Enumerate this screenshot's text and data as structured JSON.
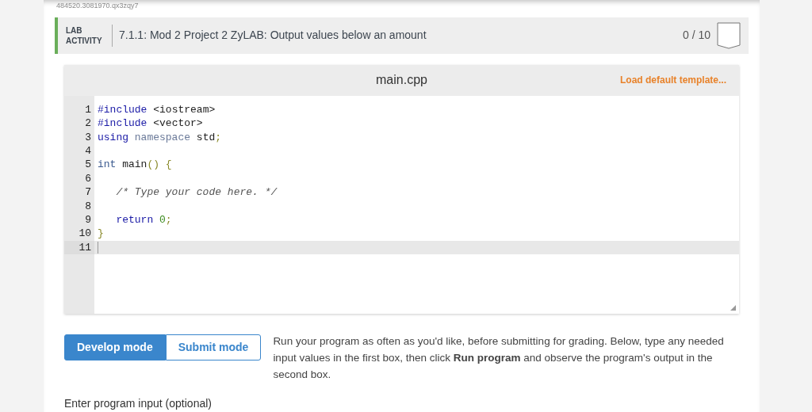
{
  "top_id": "484520.3081970.qx3zqy7",
  "activity": {
    "label": "LAB ACTIVITY",
    "title": "7.1.1: Mod 2 Project 2 ZyLAB: Output values below an amount",
    "score": "0 / 10",
    "completed": false
  },
  "editor": {
    "filename": "main.cpp",
    "load_template": "Load default template...",
    "lines": [
      {
        "number": "1",
        "current": false,
        "tokens": [
          {
            "kind": "keyword",
            "text": "#include"
          },
          {
            "kind": "plain",
            "text": " <iostream>"
          }
        ]
      },
      {
        "number": "2",
        "current": false,
        "tokens": [
          {
            "kind": "keyword",
            "text": "#include"
          },
          {
            "kind": "plain",
            "text": " <vector>"
          }
        ]
      },
      {
        "number": "3",
        "current": false,
        "tokens": [
          {
            "kind": "keyword",
            "text": "using"
          },
          {
            "kind": "muted",
            "text": " namespace"
          },
          {
            "kind": "plain",
            "text": " std"
          },
          {
            "kind": "punct",
            "text": ";"
          }
        ]
      },
      {
        "number": "4",
        "current": false
      },
      {
        "number": "5",
        "current": false,
        "tokens": [
          {
            "kind": "type",
            "text": "int"
          },
          {
            "kind": "plain",
            "text": " main"
          },
          {
            "kind": "punct",
            "text": "() {"
          }
        ]
      },
      {
        "number": "6",
        "current": false
      },
      {
        "number": "7",
        "current": false,
        "tokens": [
          {
            "kind": "comment",
            "text": "   /* Type your code here. */"
          }
        ]
      },
      {
        "number": "8",
        "current": false
      },
      {
        "number": "9",
        "current": false,
        "tokens": [
          {
            "kind": "keyword",
            "text": "   return"
          },
          {
            "kind": "number",
            "text": " 0"
          },
          {
            "kind": "punct",
            "text": ";"
          }
        ]
      },
      {
        "number": "10",
        "current": false,
        "tokens": [
          {
            "kind": "punct",
            "text": "}"
          }
        ]
      },
      {
        "number": "11",
        "current": true
      }
    ]
  },
  "modes": [
    {
      "label": "Develop mode",
      "selected": true
    },
    {
      "label": "Submit mode",
      "selected": false
    }
  ],
  "instructions": "Run your program as often as you'd like, before submitting for grading. Below, type any needed input values in the first box, then click **Run program** and observe the program's output in the second box.",
  "input_label": "Enter program input (optional)"
}
